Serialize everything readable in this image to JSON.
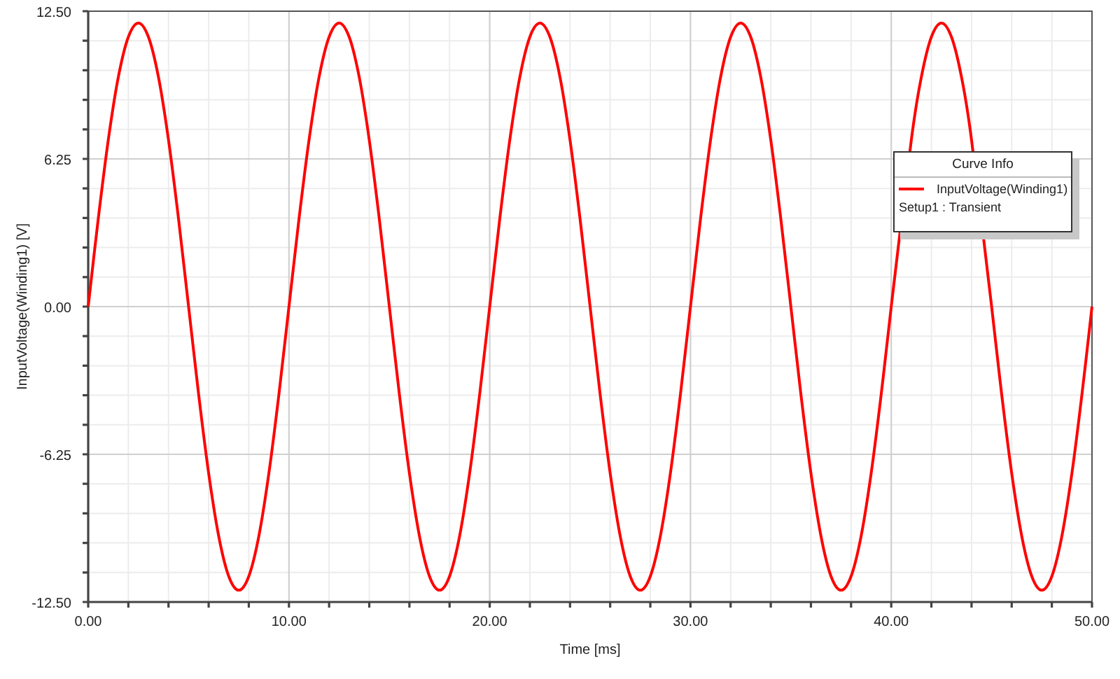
{
  "plot": {
    "chart_data": {
      "type": "line",
      "xlabel": "Time [ms]",
      "ylabel": "InputVoltage(Winding1) [V]",
      "x": [
        0,
        0.5,
        1,
        1.5,
        2,
        2.5,
        3,
        3.5,
        4,
        4.5,
        5,
        5.5,
        6,
        6.5,
        7,
        7.5,
        8,
        8.5,
        9,
        9.5,
        10,
        10.5,
        11,
        11.5,
        12,
        12.5,
        13,
        13.5,
        14,
        14.5,
        15,
        15.5,
        16,
        16.5,
        17,
        17.5,
        18,
        18.5,
        19,
        19.5,
        20,
        20.5,
        21,
        21.5,
        22,
        22.5,
        23,
        23.5,
        24,
        24.5,
        25,
        25.5,
        26,
        26.5,
        27,
        27.5,
        28,
        28.5,
        29,
        29.5,
        30,
        30.5,
        31,
        31.5,
        32,
        32.5,
        33,
        33.5,
        34,
        34.5,
        35,
        35.5,
        36,
        36.5,
        37,
        37.5,
        38,
        38.5,
        39,
        39.5,
        40,
        41,
        41.5,
        42,
        42.5,
        43,
        43.5,
        44,
        45,
        45.5,
        46,
        46.5,
        47,
        47.5,
        48,
        48.5,
        49,
        49.5,
        50
      ],
      "series": [
        {
          "name": "InputVoltage(Winding1)",
          "color": "#ff0000",
          "values": [
            0,
            3.71,
            7.05,
            9.71,
            11.41,
            12,
            11.41,
            9.71,
            7.05,
            3.71,
            0,
            -3.71,
            -7.05,
            -9.71,
            -11.41,
            -12,
            -11.41,
            -9.71,
            -7.05,
            -3.71,
            0,
            3.71,
            7.05,
            9.71,
            11.41,
            12,
            11.41,
            9.71,
            7.05,
            3.71,
            0,
            -3.71,
            -7.05,
            -9.71,
            -11.41,
            -12,
            -11.41,
            -9.71,
            -7.05,
            -3.71,
            0,
            3.71,
            7.05,
            9.71,
            11.41,
            12,
            11.41,
            9.71,
            7.05,
            3.71,
            0,
            -3.71,
            -7.05,
            -9.71,
            -11.41,
            -12,
            -11.41,
            -9.71,
            -7.05,
            -3.71,
            0,
            3.71,
            7.05,
            9.71,
            11.41,
            12,
            11.41,
            9.71,
            7.05,
            3.71,
            0,
            -3.71,
            -7.05,
            -9.71,
            -11.41,
            -12,
            -11.41,
            -9.71,
            -7.05,
            -3.71,
            0,
            7.05,
            9.71,
            11.41,
            12,
            11.41,
            9.71,
            7.05,
            0,
            -3.71,
            -7.05,
            -9.71,
            -11.41,
            -12,
            -11.41,
            -9.71,
            -7.05,
            -3.71,
            0
          ]
        }
      ],
      "grid": true,
      "xlim": [
        0,
        50
      ],
      "ylim": [
        -12.5,
        12.5
      ],
      "xticks": [
        {
          "value": 0,
          "label": "0.00"
        },
        {
          "value": 10,
          "label": "10.00"
        },
        {
          "value": 20,
          "label": "20.00"
        },
        {
          "value": 30,
          "label": "30.00"
        },
        {
          "value": 40,
          "label": "40.00"
        },
        {
          "value": 50,
          "label": "50.00"
        }
      ],
      "yticks": [
        {
          "value": -12.5,
          "label": "-12.50"
        },
        {
          "value": -6.25,
          "label": "-6.25"
        },
        {
          "value": 0,
          "label": "0.00"
        },
        {
          "value": 6.25,
          "label": "6.25"
        },
        {
          "value": 12.5,
          "label": "12.50"
        }
      ]
    }
  },
  "legend": {
    "title": "Curve Info",
    "note": "Setup1 : Transient"
  }
}
